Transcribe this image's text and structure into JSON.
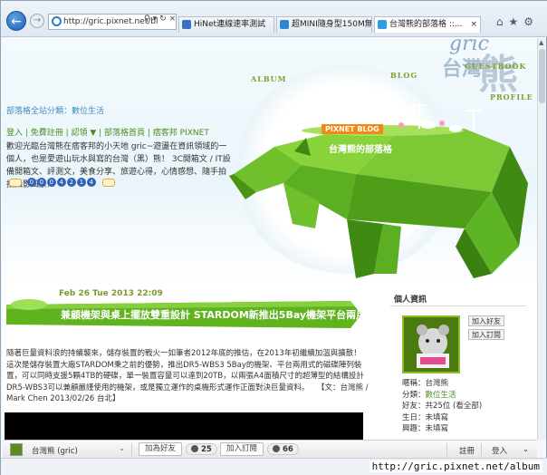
{
  "browser": {
    "address": "http://gric.pixnet.net/bl",
    "tabs": [
      {
        "label": "HiNet連線速率測試"
      },
      {
        "label": "超MINI隨身型150M無..."
      },
      {
        "label": "台灣熊的部落格 ::..."
      }
    ],
    "status_url": "http://gric.pixnet.net/album"
  },
  "banner": {
    "logo_text": "gric",
    "logo_cn1": "台灣",
    "logo_cn2": "熊",
    "menu_album": "ALBUM",
    "menu_blog": "BLOG",
    "menu_guestbook": "GUESTBOOK",
    "menu_profile": "PROFILE",
    "tag": "PIXNET BLOG",
    "blog_name": "台灣熊的部落格",
    "category_line": "部落格全站分類：數位生活",
    "nav_links": "登入 | 免費註冊 | 認領 ▼ | 部落格首頁 | 痞客邦 PIXNET",
    "description": "歡迎光臨台灣熊在痞客邦的小天地 gric~遊盪在資訊領域的一個人，也是愛遊山玩水與寫的台灣（黑）熊！ 3C開箱文 / IT設備開箱文、評測文，美食分享、旅遊心得，心情感想、隨手拍拍攝影風景...",
    "badge_digits": [
      "0",
      "0",
      "0",
      "4",
      "2",
      "1",
      "4"
    ]
  },
  "post": {
    "date": "Feb 26 Tue 2013 22:09",
    "title": "兼顧機架與桌上擺放雙重設計 STARDOM新推出5Bay機架平台兩用式磁碟陣列",
    "body": "隨著巨量資料浪的持續襲來，儲存裝置的戰火一如筆者2012年底的推估，在2013年初繼續加溫與擴散！這次是儲存裝置大廠STARDOM秉之前的優勢，推出DR5-WBS3 5Bay的機架、平台兩用式的磁碟陣列裝置，可以同時支援5顆4TB的硬碟，單一裝置容量可以達到20TB，以兩張A4面積尺寸的超薄型的結構設計DR5-WBS3可以兼顧嚴謹使用的機架，或是獨立運作的桌機形式運作正面對決巨量資料。　　【文：台灣熊 / Mark Chen 2013/02/26 台北】"
  },
  "sidebar": {
    "title": "個人資訊",
    "add_friend": "加入好友",
    "add_subscribe": "加入訂閱",
    "rows": [
      {
        "label": "暱稱：",
        "value": "台灣熊"
      },
      {
        "label": "分類：",
        "value": "數位生活",
        "link": true
      },
      {
        "label": "好友：",
        "value": "共25位 (看全部)"
      },
      {
        "label": "生日：",
        "value": "未填寫"
      },
      {
        "label": "興趣：",
        "value": "未填寫"
      }
    ]
  },
  "pixbar": {
    "name": "台灣熊 (gric)",
    "add_friend": "加為好友",
    "friend_count": "25",
    "subscribe": "加入訂閱",
    "subscribe_count": "66",
    "register": "註冊",
    "login": "登入"
  }
}
